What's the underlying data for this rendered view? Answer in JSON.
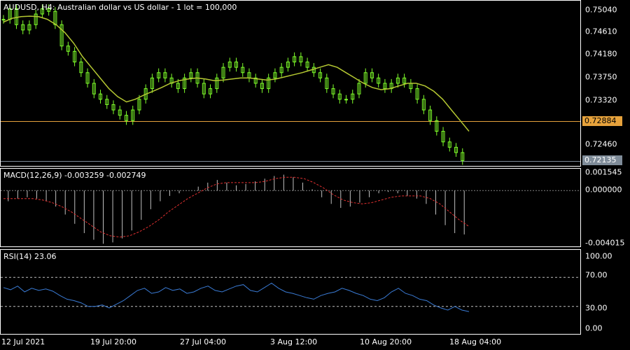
{
  "price_pane": {
    "title": "AUDUSD, H4:  Australian dollar vs US dollar - 1 lot = 100,000",
    "y_ticks": [
      "0.75040",
      "0.74610",
      "0.74180",
      "0.73750",
      "0.73320",
      "0.72460"
    ],
    "level_line_value": "0.72884",
    "current_price": "0.72135",
    "colors": {
      "candles": "#7fff2a",
      "ma": "#b5c832",
      "level_line": "#e6a23c",
      "level_tag_bg": "#e6a23c",
      "price_tag_bg": "#7f8c99"
    }
  },
  "macd_pane": {
    "title": "MACD(12,26,9) -0.003259 -0.002749",
    "y_ticks": [
      "0.001545",
      "0.000000",
      "-0.004015"
    ],
    "colors": {
      "histogram": "#c0c0c0",
      "signal": "#e03030"
    }
  },
  "rsi_pane": {
    "title": "RSI(14) 23.06",
    "y_ticks": [
      "100.00",
      "70.00",
      "30.00",
      "0.00"
    ],
    "colors": {
      "line": "#3a7bd5",
      "levels": "#c0c0c0"
    }
  },
  "x_axis": {
    "labels": [
      "12 Jul 2021",
      "19 Jul 20:00",
      "27 Jul 04:00",
      "3 Aug 12:00",
      "10 Aug 20:00",
      "18 Aug 04:00"
    ]
  },
  "chart_data": {
    "type": "candlestick",
    "symbol": "AUDUSD",
    "timeframe": "H4",
    "price_ylim": [
      0.7205,
      0.7515
    ],
    "close_series": [
      0.748,
      0.75,
      0.747,
      0.746,
      0.747,
      0.749,
      0.75,
      0.7495,
      0.747,
      0.743,
      0.742,
      0.74,
      0.738,
      0.736,
      0.734,
      0.733,
      0.732,
      0.731,
      0.73,
      0.729,
      0.731,
      0.733,
      0.735,
      0.737,
      0.738,
      0.737,
      0.736,
      0.735,
      0.737,
      0.738,
      0.736,
      0.734,
      0.735,
      0.737,
      0.739,
      0.74,
      0.739,
      0.738,
      0.737,
      0.736,
      0.735,
      0.737,
      0.738,
      0.739,
      0.74,
      0.741,
      0.74,
      0.739,
      0.738,
      0.737,
      0.735,
      0.734,
      0.733,
      0.733,
      0.734,
      0.736,
      0.738,
      0.737,
      0.736,
      0.735,
      0.736,
      0.737,
      0.736,
      0.735,
      0.733,
      0.731,
      0.729,
      0.727,
      0.725,
      0.724,
      0.723,
      0.7215
    ],
    "ma_series": [
      0.7475,
      0.7482,
      0.7485,
      0.7486,
      0.7485,
      0.748,
      0.747,
      0.7455,
      0.7435,
      0.741,
      0.739,
      0.737,
      0.735,
      0.7335,
      0.7325,
      0.733,
      0.7338,
      0.7345,
      0.7352,
      0.736,
      0.7365,
      0.7368,
      0.737,
      0.7368,
      0.7365,
      0.7366,
      0.7368,
      0.737,
      0.737,
      0.7368,
      0.7366,
      0.7368,
      0.7372,
      0.7376,
      0.738,
      0.7385,
      0.739,
      0.7395,
      0.739,
      0.738,
      0.737,
      0.736,
      0.7352,
      0.7348,
      0.735,
      0.7355,
      0.736,
      0.736,
      0.7355,
      0.7345,
      0.733,
      0.731,
      0.729,
      0.727
    ],
    "macd_histogram": [
      -0.0008,
      -0.0006,
      -0.0005,
      -0.0006,
      -0.0008,
      -0.0012,
      -0.0018,
      -0.0025,
      -0.0032,
      -0.0037,
      -0.004,
      -0.0039,
      -0.0036,
      -0.003,
      -0.0022,
      -0.0014,
      -0.0008,
      -0.0004,
      -0.0002,
      0.0,
      0.0003,
      0.0006,
      0.0008,
      0.0006,
      0.0004,
      0.0005,
      0.0007,
      0.0009,
      0.0011,
      0.0012,
      0.001,
      0.0006,
      0.0001,
      -0.0005,
      -0.001,
      -0.0013,
      -0.0012,
      -0.0009,
      -0.0005,
      -0.0002,
      -0.0001,
      -0.0002,
      -0.0004,
      -0.0006,
      -0.001,
      -0.0018,
      -0.0026,
      -0.0032,
      -0.0033
    ],
    "macd_signal": [
      -0.0006,
      -0.0006,
      -0.0006,
      -0.0006,
      -0.0007,
      -0.0009,
      -0.0012,
      -0.0016,
      -0.0021,
      -0.0026,
      -0.0031,
      -0.0034,
      -0.0035,
      -0.0034,
      -0.0031,
      -0.0027,
      -0.0022,
      -0.0016,
      -0.0011,
      -0.0006,
      -0.0002,
      0.0002,
      0.0005,
      0.0006,
      0.0006,
      0.0006,
      0.0006,
      0.0007,
      0.0009,
      0.001,
      0.001,
      0.0009,
      0.0006,
      0.0002,
      -0.0003,
      -0.0007,
      -0.0009,
      -0.001,
      -0.0009,
      -0.0007,
      -0.0005,
      -0.0004,
      -0.0004,
      -0.0004,
      -0.0006,
      -0.001,
      -0.0016,
      -0.0022,
      -0.0027
    ],
    "macd_ylim": [
      -0.0042,
      0.00165
    ],
    "rsi_series": [
      56,
      53,
      58,
      50,
      55,
      52,
      54,
      51,
      45,
      40,
      38,
      35,
      30,
      30,
      32,
      28,
      33,
      38,
      45,
      52,
      55,
      48,
      50,
      56,
      52,
      54,
      48,
      50,
      55,
      58,
      52,
      50,
      54,
      58,
      60,
      52,
      50,
      56,
      62,
      55,
      50,
      48,
      45,
      42,
      40,
      45,
      48,
      50,
      55,
      52,
      48,
      45,
      40,
      38,
      42,
      50,
      55,
      48,
      45,
      40,
      38,
      32,
      28,
      25,
      30,
      25,
      23
    ],
    "rsi_ylim": [
      0,
      100
    ],
    "rsi_levels": [
      70,
      30
    ]
  }
}
